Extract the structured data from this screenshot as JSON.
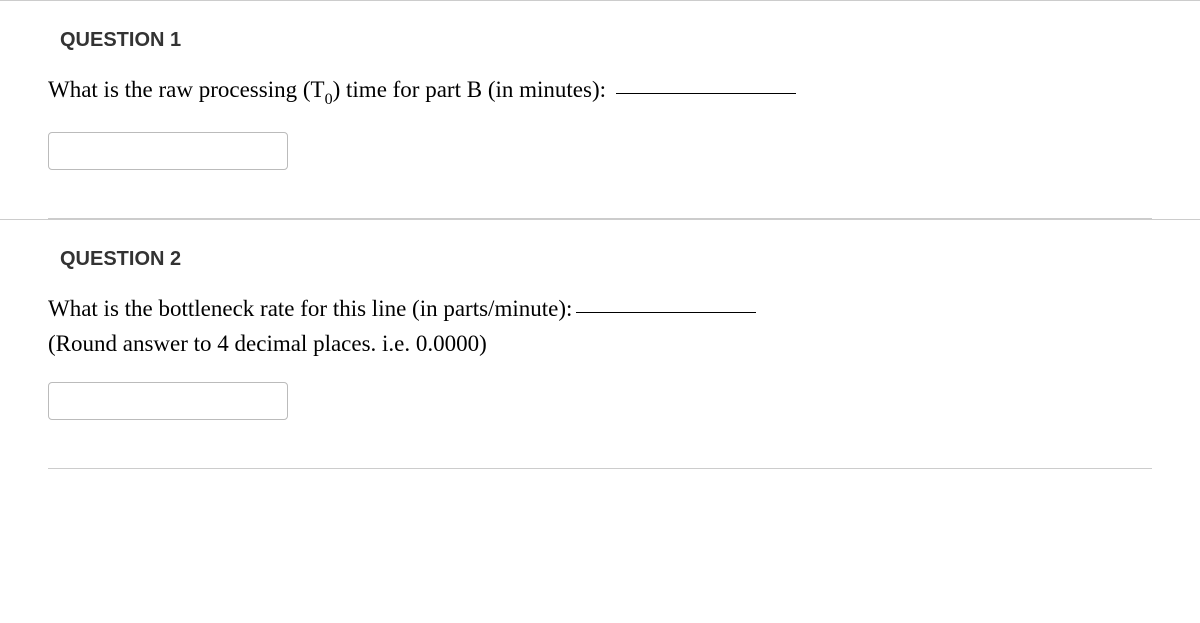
{
  "questions": [
    {
      "header": "QUESTION 1",
      "prompt_before": "What is the raw processing (T",
      "prompt_sub": "0",
      "prompt_after": ") time for part B (in minutes): ",
      "prompt_line2": "",
      "input_value": ""
    },
    {
      "header": "QUESTION 2",
      "prompt_before": "What is the bottleneck rate for this line (in parts/minute):",
      "prompt_sub": "",
      "prompt_after": "",
      "prompt_line2": "(Round answer to 4 decimal places. i.e. 0.0000)",
      "input_value": ""
    }
  ]
}
